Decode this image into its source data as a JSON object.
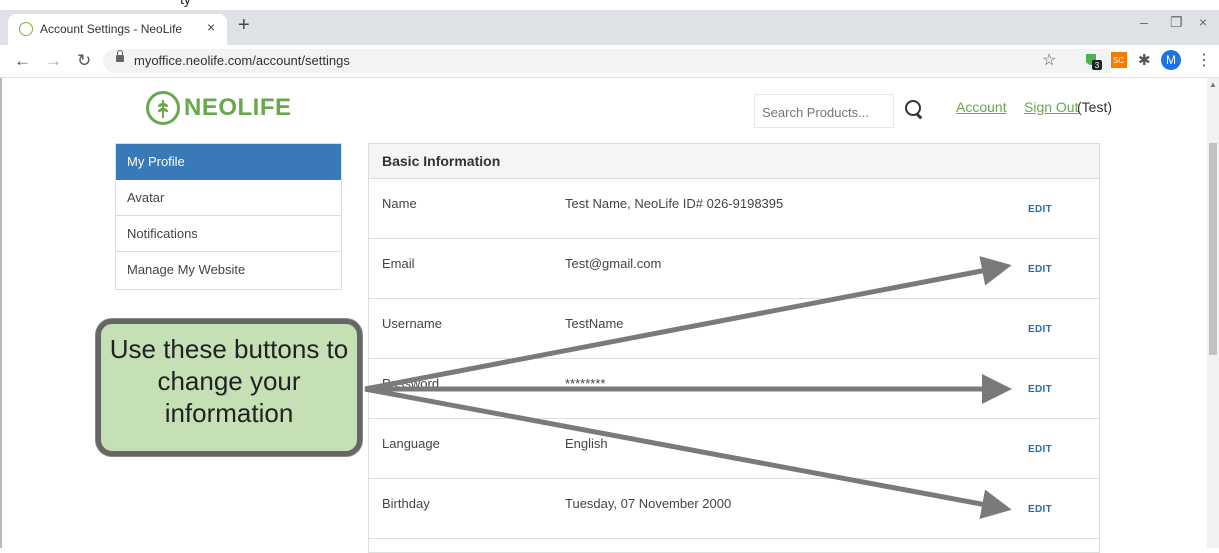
{
  "top_caption": "ty",
  "browser": {
    "tab_title": "Account Settings - NeoLife",
    "tab_close": "×",
    "new_tab": "+",
    "window_minimize": "–",
    "window_restore": "❐",
    "window_close": "×",
    "url": "myoffice.neolife.com/account/settings",
    "extension_badge": "3",
    "extension_sc": "SC",
    "profile_initial": "M"
  },
  "header": {
    "logo_text": "NEOLIFE",
    "search_placeholder": "Search Products...",
    "account_link": "Account",
    "signout_link": "Sign Out",
    "user_name": "(Test)"
  },
  "sidebar": {
    "items": [
      {
        "label": "My Profile",
        "active": true
      },
      {
        "label": "Avatar"
      },
      {
        "label": "Notifications"
      },
      {
        "label": "Manage My Website"
      }
    ]
  },
  "panel": {
    "title": "Basic Information",
    "edit_label": "EDIT",
    "rows": [
      {
        "label": "Name",
        "value": "Test Name, NeoLife ID# 026-9198395"
      },
      {
        "label": "Email",
        "value": "Test@gmail.com"
      },
      {
        "label": "Username",
        "value": "TestName"
      },
      {
        "label": "Password",
        "value": "********"
      },
      {
        "label": "Language",
        "value": "English"
      },
      {
        "label": "Birthday",
        "value": "Tuesday, 07 November 2000"
      }
    ]
  },
  "callout": {
    "text": "Use these buttons to change your information"
  },
  "colors": {
    "brand_green": "#6aa84f",
    "active_blue": "#3a79b7",
    "edit_blue": "#2e6da4",
    "callout_fill": "#c5e0b4"
  }
}
